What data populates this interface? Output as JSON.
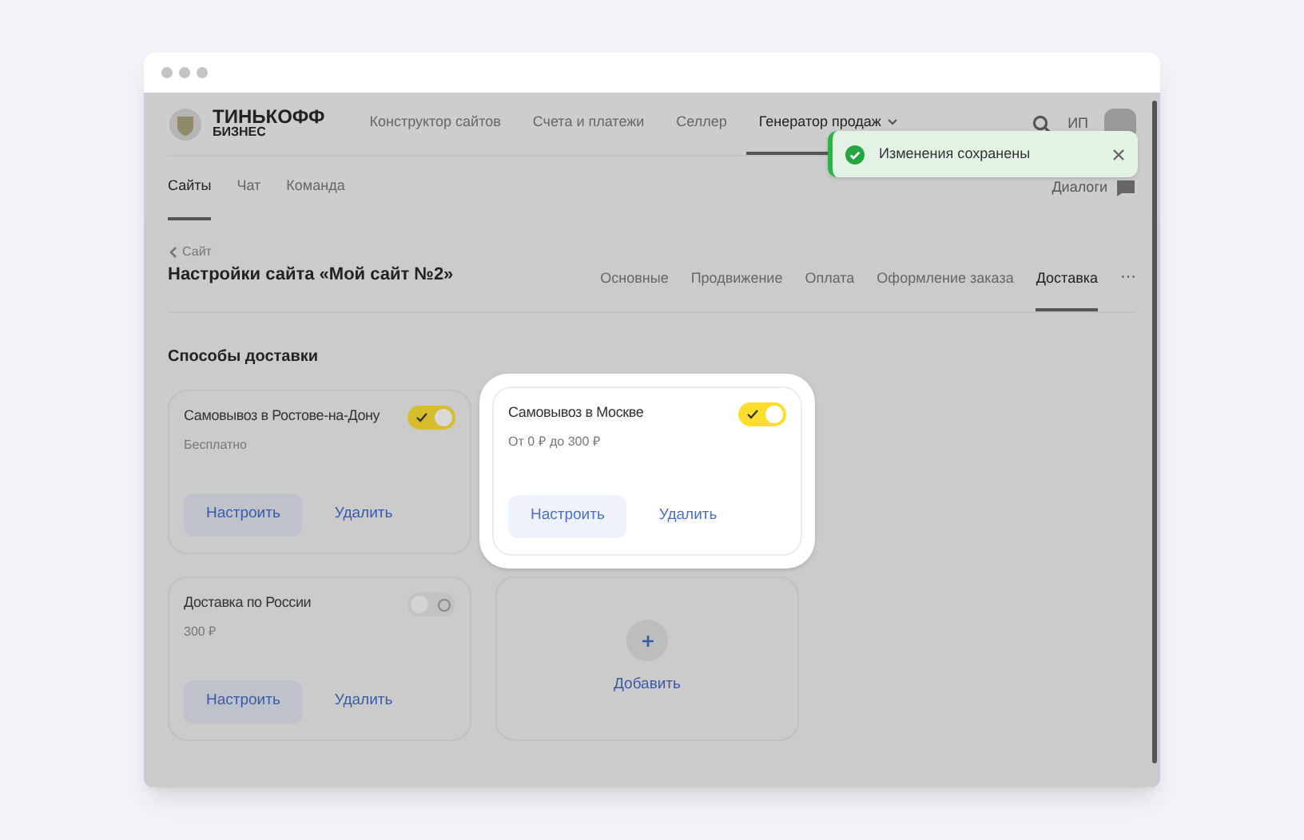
{
  "header": {
    "logo": {
      "line1": "ТИНЬКОФФ",
      "line2": "БИЗНЕС"
    },
    "nav": [
      {
        "label": "Конструктор сайтов",
        "selected": false
      },
      {
        "label": "Счета и платежи",
        "selected": false
      },
      {
        "label": "Селлер",
        "selected": false
      },
      {
        "label": "Генератор продаж",
        "selected": true
      }
    ],
    "user": "ИП"
  },
  "subnav": {
    "tabs": [
      {
        "label": "Сайты",
        "selected": true
      },
      {
        "label": "Чат",
        "selected": false
      },
      {
        "label": "Команда",
        "selected": false
      }
    ],
    "dialogs": "Диалоги"
  },
  "breadcrumb": "Сайт",
  "title": "Настройки сайта «Мой сайт №2»",
  "settings_tabs": [
    {
      "label": "Основные",
      "selected": false
    },
    {
      "label": "Продвижение",
      "selected": false
    },
    {
      "label": "Оплата",
      "selected": false
    },
    {
      "label": "Оформление заказа",
      "selected": false
    },
    {
      "label": "Доставка",
      "selected": true
    }
  ],
  "more": "···",
  "section_title": "Способы доставки",
  "cards": [
    {
      "kind": "method",
      "title": "Самовывоз в Ростове-на-Дону",
      "price": "Бесплатно",
      "on": true,
      "highlighted": false,
      "configure": "Настроить",
      "delete": "Удалить"
    },
    {
      "kind": "method",
      "title": "Самовывоз в Москве",
      "price": "От 0 ₽ до 300 ₽",
      "on": true,
      "highlighted": true,
      "configure": "Настроить",
      "delete": "Удалить"
    },
    {
      "kind": "method",
      "title": "Доставка по России",
      "price": "300 ₽",
      "on": false,
      "highlighted": false,
      "configure": "Настроить",
      "delete": "Удалить"
    },
    {
      "kind": "add",
      "label": "Добавить",
      "highlighted": false
    }
  ],
  "toast": {
    "message": "Изменения сохранены"
  }
}
